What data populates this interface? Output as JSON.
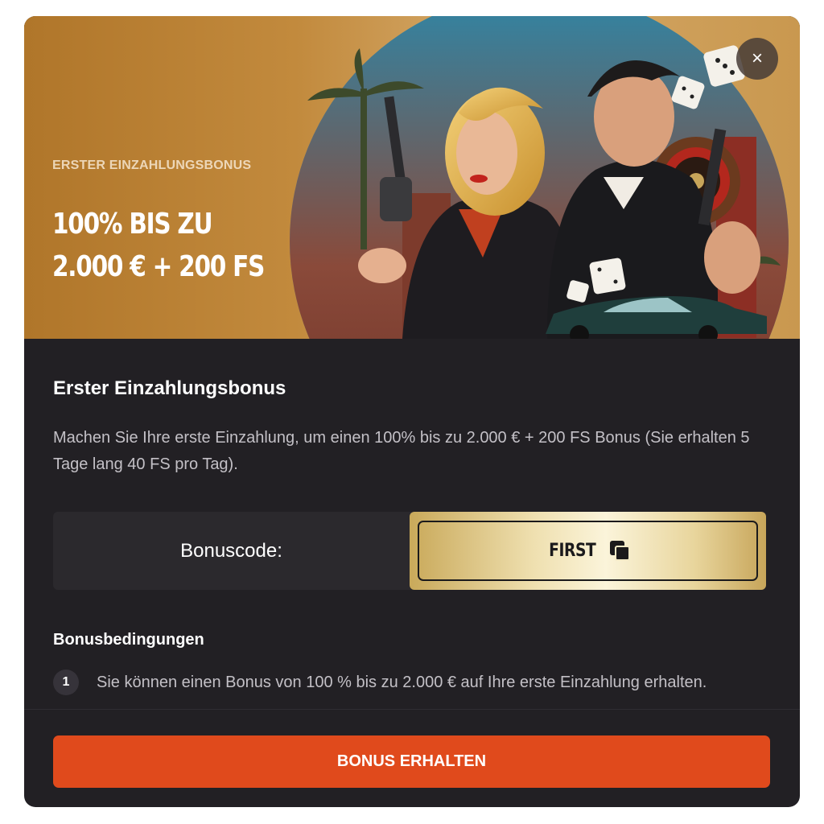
{
  "banner": {
    "eyebrow": "ERSTER EINZAHLUNGSBONUS",
    "headline_line1": "100% BIS ZU",
    "headline_line2": "2.000 € + 200 FS",
    "close_label": "×"
  },
  "content": {
    "title": "Erster Einzahlungsbonus",
    "description": "Machen Sie Ihre erste Einzahlung, um einen 100% bis zu 2.000 € + 200 FS Bonus (Sie erhalten 5 Tage lang 40 FS pro Tag)."
  },
  "bonus_code": {
    "label": "Bonuscode:",
    "code": "FIRST",
    "copy_icon": "copy-icon"
  },
  "conditions": {
    "title": "Bonusbedingungen",
    "items": [
      {
        "number": "1",
        "text": "Sie können einen Bonus von 100 % bis zu 2.000 € auf Ihre erste Einzahlung erhalten."
      }
    ]
  },
  "cta": {
    "label": "BONUS ERHALTEN"
  },
  "colors": {
    "modal_bg": "#222024",
    "accent": "#e04a1c",
    "gold": "#efe0b0"
  }
}
